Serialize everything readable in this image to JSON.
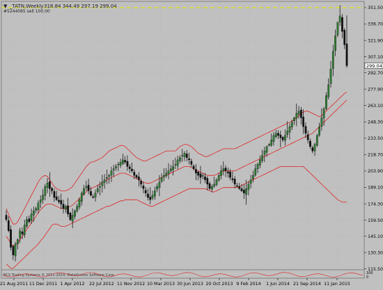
{
  "header": {
    "dropdown_glyph": "▼",
    "symbol_timeframe": "_TATN,Weekly",
    "ohlc": "318.84 344.49 297.19 299.04"
  },
  "order_line": {
    "label": "#5244065 sell 100.00"
  },
  "current_price_label": "299.04",
  "indicator_label": "BCS Trading Systems © 2011-2014, MetaQuotes Software Corp.",
  "indicator_scale": {
    "top": "100",
    "bottom": "0"
  },
  "colors": {
    "background": "#c0c0c0",
    "bull_candle": "#2e7d32",
    "bear_candle": "#111111",
    "bands": "#e02020",
    "order_line": "#e6e600",
    "grid": "#a8a8a8"
  },
  "chart_data": {
    "type": "candlestick",
    "title": "_TATN,Weekly",
    "timeframe": "Weekly",
    "last": {
      "open": 318.84,
      "high": 344.49,
      "low": 297.19,
      "close": 299.04
    },
    "order_level": 351.5,
    "ylim": [
      115.3,
      356.5
    ],
    "y_ticks": [
      "351.50",
      "336.70",
      "321.90",
      "307.10",
      "292.70",
      "277.90",
      "263.10",
      "248.30",
      "233.50",
      "218.70",
      "203.90",
      "189.10",
      "174.30",
      "159.50",
      "145.10",
      "130.30",
      "115.50"
    ],
    "x_ticks": [
      "21 Aug 2011",
      "11 Dec 2011",
      "1 Apr 2012",
      "22 Jul 2012",
      "11 Nov 2012",
      "10 Mar 2013",
      "30 Jun 2013",
      "20 Oct 2013",
      "9 Feb 2014",
      "1 Jun 2014",
      "21 Sep 2014",
      "11 Jan 2015"
    ],
    "series": [
      {
        "name": "price",
        "approx_closes": [
          160,
          150,
          135,
          128,
          138,
          142,
          150,
          147,
          155,
          160,
          158,
          165,
          168,
          170,
          175,
          178,
          182,
          190,
          193,
          188,
          186,
          180,
          178,
          176,
          174,
          170,
          172,
          165,
          160,
          164,
          168,
          172,
          178,
          184,
          188,
          190,
          186,
          182,
          180,
          184,
          188,
          190,
          194,
          196,
          198,
          200,
          204,
          206,
          208,
          210,
          212,
          214,
          212,
          208,
          206,
          204,
          200,
          198,
          196,
          192,
          188,
          184,
          180,
          178,
          182,
          186,
          190,
          194,
          198,
          200,
          202,
          204,
          206,
          208,
          210,
          214,
          216,
          218,
          220,
          216,
          214,
          210,
          206,
          202,
          200,
          198,
          200,
          196,
          192,
          188,
          190,
          192,
          196,
          200,
          204,
          206,
          204,
          202,
          198,
          196,
          192,
          190,
          188,
          186,
          184,
          188,
          192,
          196,
          200,
          206,
          210,
          214,
          218,
          222,
          226,
          228,
          232,
          236,
          238,
          236,
          234,
          232,
          236,
          240,
          244,
          248,
          252,
          256,
          258,
          252,
          244,
          238,
          232,
          226,
          222,
          228,
          236,
          244,
          252,
          260,
          272,
          282,
          296,
          312,
          326,
          338,
          344,
          330,
          318,
          299.04
        ]
      },
      {
        "name": "upper_band",
        "approx_values": [
          170,
          165,
          160,
          156,
          156,
          158,
          162,
          166,
          170,
          174,
          178,
          182,
          186,
          190,
          194,
          197,
          199,
          200,
          199,
          196,
          193,
          190,
          188,
          187,
          186,
          186,
          186,
          187,
          188,
          190,
          193,
          196,
          199,
          202,
          205,
          208,
          210,
          212,
          212,
          213,
          214,
          215,
          216,
          218,
          220,
          222,
          223,
          224,
          225,
          226,
          227,
          227,
          226,
          224,
          222,
          220,
          218,
          216,
          215,
          214,
          213,
          213,
          214,
          215,
          216,
          217,
          218,
          219,
          220,
          221,
          222,
          222,
          222,
          222,
          222,
          224,
          226,
          227,
          228,
          228,
          227,
          226,
          224,
          222,
          220,
          219,
          218,
          217,
          217,
          218,
          219,
          220,
          221,
          222,
          223,
          224,
          224,
          224,
          224,
          224,
          224,
          225,
          226,
          227,
          228,
          229,
          230,
          231,
          232,
          233,
          234,
          235,
          236,
          237,
          238,
          239,
          240,
          241,
          242,
          243,
          244,
          245,
          246,
          247,
          248,
          249,
          250,
          252,
          254,
          256,
          257,
          258,
          258,
          257,
          256,
          255,
          254,
          253,
          254,
          256,
          258,
          260,
          262,
          264,
          266,
          268,
          270,
          272,
          274,
          275
        ]
      },
      {
        "name": "middle_band",
        "approx_values": [
          145,
          142,
          138,
          136,
          137,
          139,
          142,
          145,
          148,
          151,
          154,
          157,
          160,
          163,
          166,
          169,
          171,
          173,
          174,
          174,
          174,
          173,
          172,
          171,
          170,
          170,
          170,
          171,
          172,
          173,
          175,
          177,
          179,
          181,
          183,
          185,
          187,
          188,
          189,
          190,
          191,
          192,
          193,
          194,
          196,
          197,
          198,
          199,
          200,
          201,
          202,
          202,
          202,
          201,
          200,
          199,
          198,
          197,
          196,
          195,
          194,
          193,
          193,
          193,
          194,
          195,
          196,
          197,
          198,
          199,
          200,
          201,
          202,
          203,
          204,
          205,
          206,
          207,
          208,
          208,
          208,
          207,
          206,
          205,
          204,
          203,
          202,
          201,
          200,
          200,
          200,
          200,
          201,
          202,
          203,
          204,
          204,
          204,
          204,
          204,
          204,
          205,
          206,
          207,
          208,
          209,
          210,
          211,
          212,
          213,
          214,
          215,
          216,
          217,
          218,
          219,
          220,
          221,
          222,
          223,
          224,
          225,
          226,
          227,
          228,
          229,
          230,
          231,
          232,
          233,
          234,
          235,
          236,
          237,
          238,
          240,
          242,
          244,
          246,
          248,
          250,
          252,
          254,
          256,
          258,
          260,
          262,
          264,
          266,
          268
        ]
      },
      {
        "name": "lower_band",
        "approx_values": [
          120,
          118,
          116,
          116,
          118,
          120,
          122,
          124,
          126,
          128,
          130,
          132,
          134,
          136,
          138,
          141,
          143,
          146,
          149,
          152,
          155,
          156,
          156,
          155,
          154,
          154,
          154,
          155,
          156,
          157,
          158,
          159,
          160,
          161,
          162,
          163,
          164,
          165,
          166,
          167,
          168,
          169,
          170,
          171,
          172,
          172,
          173,
          174,
          175,
          176,
          177,
          177,
          178,
          178,
          178,
          178,
          178,
          178,
          177,
          176,
          175,
          174,
          173,
          172,
          172,
          173,
          174,
          175,
          176,
          177,
          178,
          179,
          180,
          181,
          182,
          183,
          184,
          185,
          186,
          187,
          188,
          188,
          188,
          188,
          188,
          188,
          188,
          188,
          187,
          186,
          185,
          185,
          186,
          187,
          188,
          189,
          189,
          189,
          189,
          189,
          189,
          189,
          190,
          191,
          192,
          193,
          194,
          195,
          196,
          197,
          198,
          199,
          200,
          201,
          202,
          203,
          204,
          205,
          206,
          207,
          208,
          208,
          208,
          208,
          208,
          208,
          208,
          208,
          208,
          208,
          208,
          206,
          204,
          202,
          200,
          198,
          196,
          194,
          192,
          190,
          188,
          186,
          184,
          182,
          180,
          178,
          177,
          176,
          176,
          176
        ]
      }
    ]
  }
}
